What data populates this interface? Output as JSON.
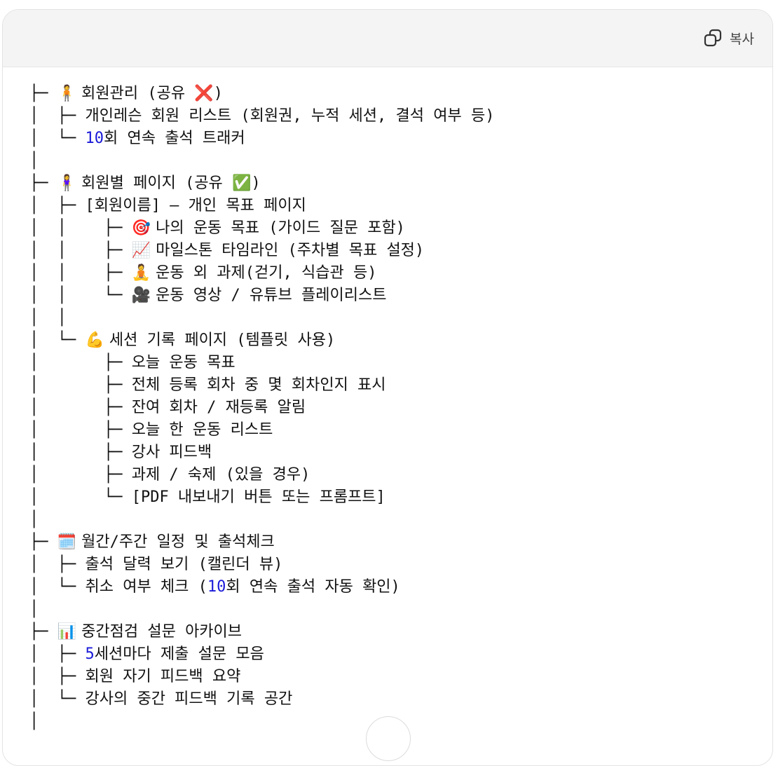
{
  "header": {
    "copy_label": "복사"
  },
  "colors": {
    "number": "#1a1ad8",
    "header_bg": "#f4f4f4",
    "border": "#e3e3e3"
  },
  "lines": [
    {
      "prefix": "├─ ",
      "icon": "person-icon",
      "glyph": "🧍",
      "parts": [
        {
          "t": "회원관리 (공유 "
        },
        {
          "t": "❌"
        },
        {
          "t": ")"
        }
      ]
    },
    {
      "prefix": "│  ├─ ",
      "parts": [
        {
          "t": "개인레슨 회원 리스트 (회원권, 누적 세션, 결석 여부 등)"
        }
      ]
    },
    {
      "prefix": "│  └─ ",
      "parts": [
        {
          "t": "10",
          "num": true
        },
        {
          "t": "회 연속 출석 트래커"
        }
      ]
    },
    {
      "prefix": "│",
      "parts": []
    },
    {
      "prefix": "├─ ",
      "icon": "woman-icon",
      "glyph": "🧍‍♀️",
      "parts": [
        {
          "t": "회원별 페이지 (공유 "
        },
        {
          "t": "✅"
        },
        {
          "t": ")"
        }
      ]
    },
    {
      "prefix": "│  ├─ ",
      "parts": [
        {
          "t": "[회원이름] – 개인 목표 페이지"
        }
      ]
    },
    {
      "prefix": "│  │    ├─ ",
      "icon": "target-icon",
      "glyph": "🎯",
      "parts": [
        {
          "t": "나의 운동 목표 (가이드 질문 포함)"
        }
      ]
    },
    {
      "prefix": "│  │    ├─ ",
      "icon": "chart-up-icon",
      "glyph": "📈",
      "parts": [
        {
          "t": "마일스톤 타임라인 (주차별 목표 설정)"
        }
      ]
    },
    {
      "prefix": "│  │    ├─ ",
      "icon": "meditation-icon",
      "glyph": "🧘",
      "parts": [
        {
          "t": "운동 외 과제(걷기, 식습관 등)"
        }
      ]
    },
    {
      "prefix": "│  │    └─ ",
      "icon": "video-camera-icon",
      "glyph": "🎥",
      "parts": [
        {
          "t": "운동 영상 / 유튜브 플레이리스트"
        }
      ]
    },
    {
      "prefix": "│  │",
      "parts": []
    },
    {
      "prefix": "│  └─ ",
      "icon": "muscle-icon",
      "glyph": "💪",
      "parts": [
        {
          "t": "세션 기록 페이지 (템플릿 사용)"
        }
      ]
    },
    {
      "prefix": "│       ├─ ",
      "parts": [
        {
          "t": "오늘 운동 목표"
        }
      ]
    },
    {
      "prefix": "│       ├─ ",
      "parts": [
        {
          "t": "전체 등록 회차 중 몇 회차인지 표시"
        }
      ]
    },
    {
      "prefix": "│       ├─ ",
      "parts": [
        {
          "t": "잔여 회차 / 재등록 알림"
        }
      ]
    },
    {
      "prefix": "│       ├─ ",
      "parts": [
        {
          "t": "오늘 한 운동 리스트"
        }
      ]
    },
    {
      "prefix": "│       ├─ ",
      "parts": [
        {
          "t": "강사 피드백"
        }
      ]
    },
    {
      "prefix": "│       ├─ ",
      "parts": [
        {
          "t": "과제 / 숙제 (있을 경우)"
        }
      ]
    },
    {
      "prefix": "│       └─ ",
      "parts": [
        {
          "t": "[PDF 내보내기 버튼 또는 프롬프트]"
        }
      ]
    },
    {
      "prefix": "│",
      "parts": []
    },
    {
      "prefix": "├─ ",
      "icon": "calendar-icon",
      "glyph": "🗓️",
      "parts": [
        {
          "t": "월간/주간 일정 및 출석체크"
        }
      ]
    },
    {
      "prefix": "│  ├─ ",
      "parts": [
        {
          "t": "출석 달력 보기 (캘린더 뷰)"
        }
      ]
    },
    {
      "prefix": "│  └─ ",
      "parts": [
        {
          "t": "취소 여부 체크 ("
        },
        {
          "t": "10",
          "num": true
        },
        {
          "t": "회 연속 출석 자동 확인)"
        }
      ]
    },
    {
      "prefix": "│",
      "parts": []
    },
    {
      "prefix": "├─ ",
      "icon": "bar-chart-icon",
      "glyph": "📊",
      "parts": [
        {
          "t": "중간점검 설문 아카이브"
        }
      ]
    },
    {
      "prefix": "│  ├─ ",
      "parts": [
        {
          "t": "5",
          "num": true
        },
        {
          "t": "세션마다 제출 설문 모음"
        }
      ]
    },
    {
      "prefix": "│  ├─ ",
      "parts": [
        {
          "t": "회원 자기 피드백 요약"
        }
      ]
    },
    {
      "prefix": "│  └─ ",
      "parts": [
        {
          "t": "강사의 중간 피드백 기록 공간"
        }
      ]
    },
    {
      "prefix": "│",
      "parts": []
    }
  ]
}
